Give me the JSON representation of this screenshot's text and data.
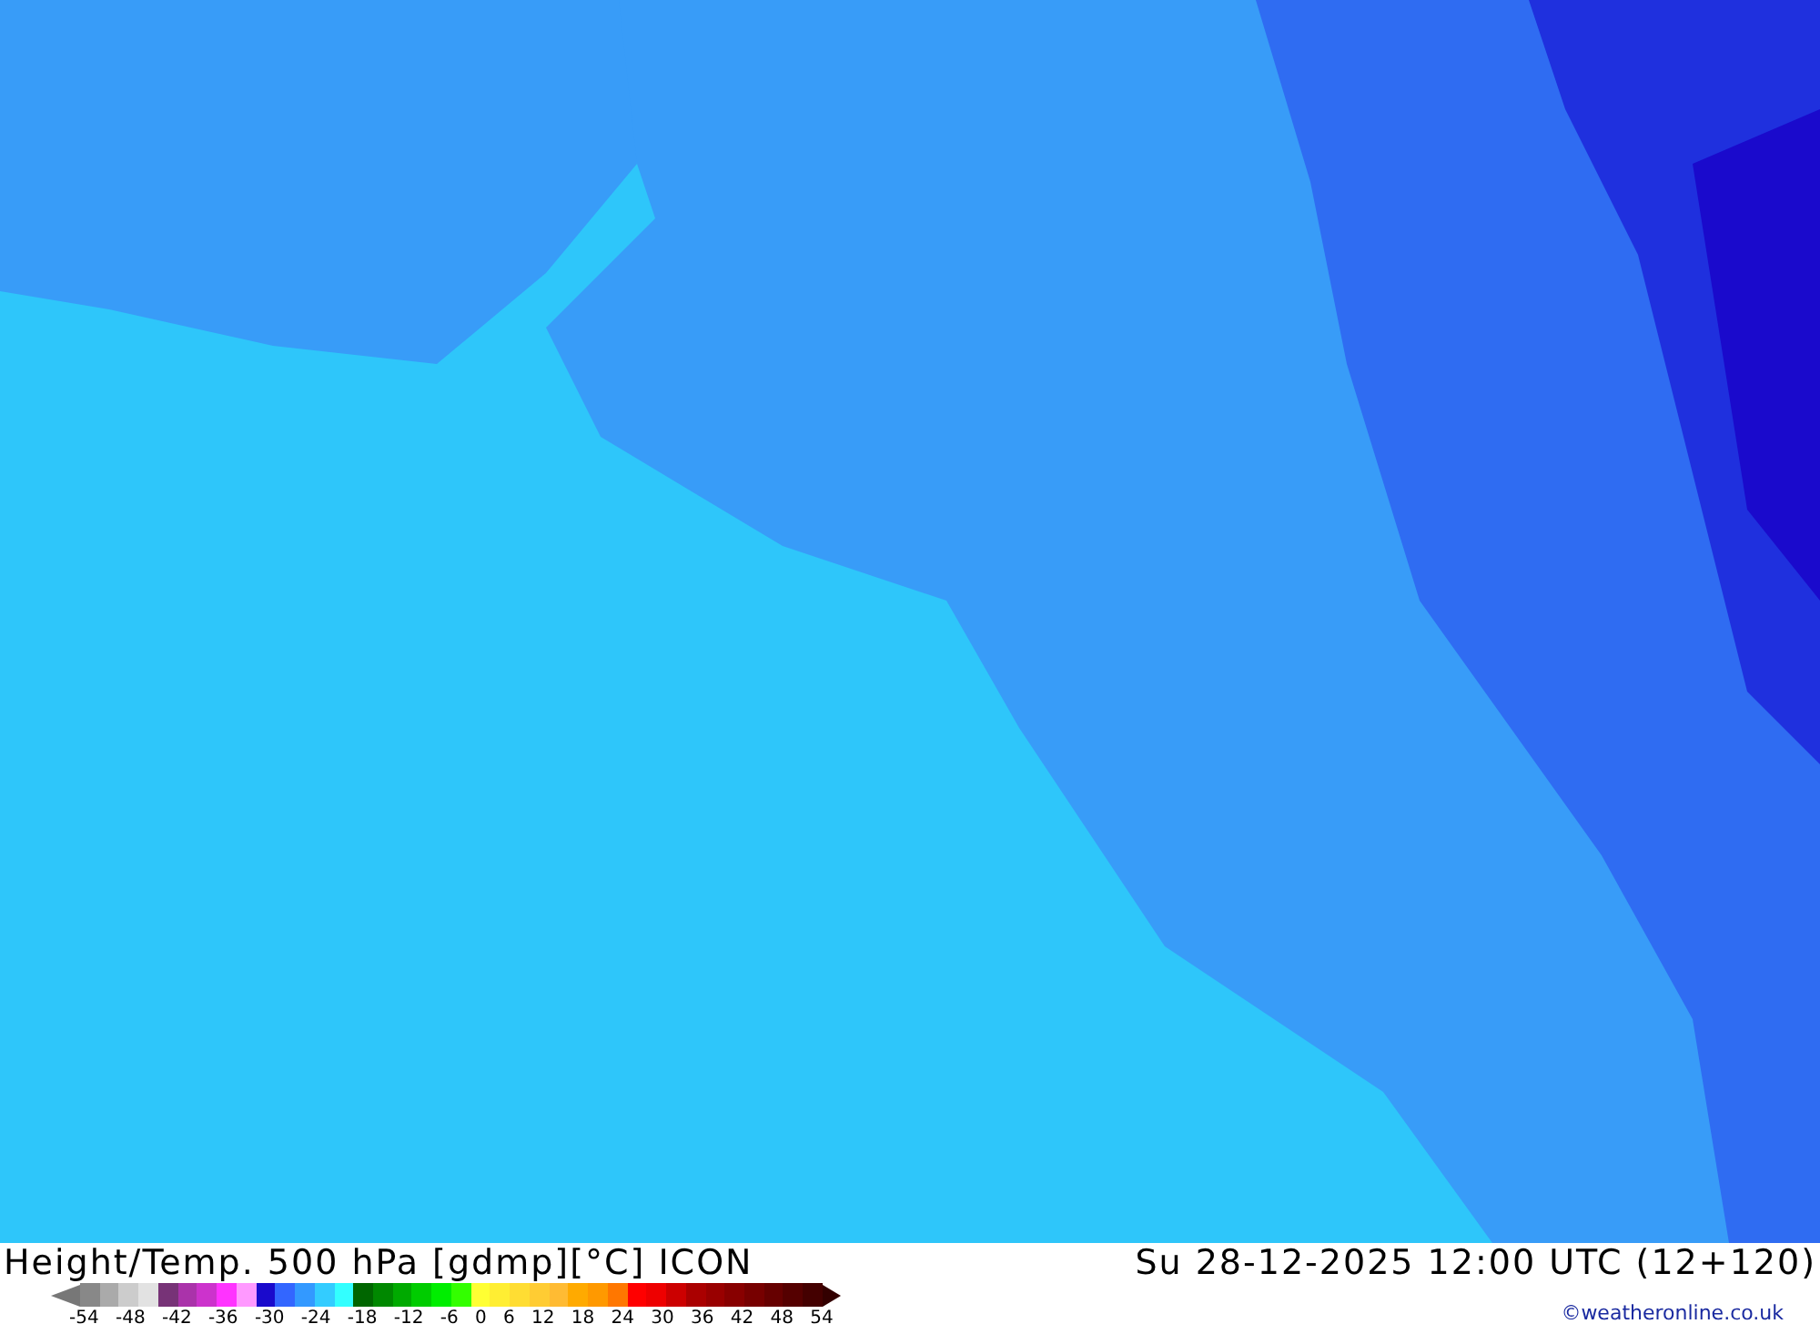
{
  "title": "Height/Temp. 500 hPa [gdmp][°C] ICON",
  "valid_time": "Su 28-12-2025 12:00 UTC (12+120)",
  "legend": {
    "swatches": [
      {
        "kind": "arrow-left",
        "color": "#777777"
      },
      {
        "color": "#888888"
      },
      {
        "color": "#aaaaaa"
      },
      {
        "color": "#cccccc"
      },
      {
        "color": "#e2e2e2"
      },
      {
        "color": "#773377"
      },
      {
        "color": "#aa33aa"
      },
      {
        "color": "#cc33cc"
      },
      {
        "color": "#ff33ff"
      },
      {
        "color": "#ff99ff"
      },
      {
        "color": "#1a0acc"
      },
      {
        "color": "#3366ff"
      },
      {
        "color": "#3399ff"
      },
      {
        "color": "#33ccff"
      },
      {
        "color": "#33ffff"
      },
      {
        "color": "#006600"
      },
      {
        "color": "#008800"
      },
      {
        "color": "#00aa00"
      },
      {
        "color": "#00cc00"
      },
      {
        "color": "#00ee00"
      },
      {
        "color": "#33ff00"
      },
      {
        "color": "#ffff33"
      },
      {
        "color": "#ffee33"
      },
      {
        "color": "#ffdd33"
      },
      {
        "color": "#ffcc33"
      },
      {
        "color": "#ffbb33"
      },
      {
        "color": "#ffaa00"
      },
      {
        "color": "#ff9900"
      },
      {
        "color": "#ff7700"
      },
      {
        "color": "#ff0000"
      },
      {
        "color": "#ee0000"
      },
      {
        "color": "#cc0000"
      },
      {
        "color": "#aa0000"
      },
      {
        "color": "#990000"
      },
      {
        "color": "#880000"
      },
      {
        "color": "#770000"
      },
      {
        "color": "#660000"
      },
      {
        "color": "#550000"
      },
      {
        "color": "#440000"
      },
      {
        "kind": "arrow-right",
        "color": "#330000"
      }
    ],
    "labels": [
      "-54",
      "-48",
      "-42",
      "-36",
      "-30",
      "-24",
      "-18",
      "-12",
      "-6",
      "0",
      "6",
      "12",
      "18",
      "24",
      "30",
      "36",
      "42",
      "48",
      "54"
    ]
  },
  "credit": "©weatheronline.co.uk"
}
